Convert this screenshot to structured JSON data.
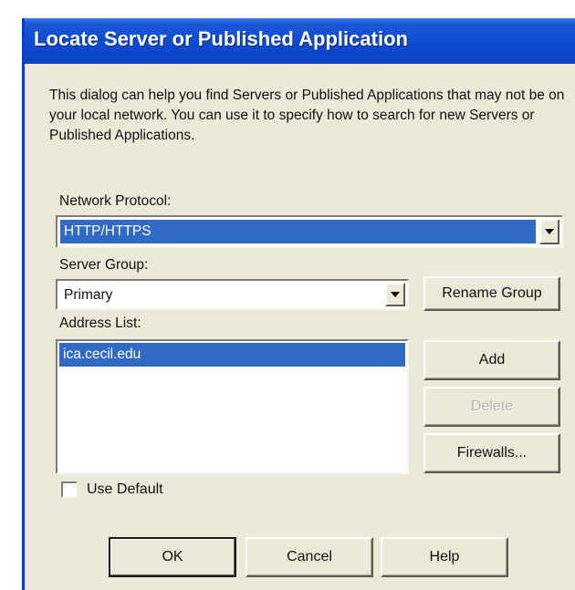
{
  "dialog": {
    "title": "Locate Server or Published Application",
    "description": "This dialog can help you find Servers or Published Applications that may not be on your local network.  You can use it to specify how to search for new Servers or Published Applications."
  },
  "network_protocol": {
    "label": "Network Protocol:",
    "value": "HTTP/HTTPS"
  },
  "server_group": {
    "label": "Server Group:",
    "value": "Primary",
    "rename_label": "Rename Group"
  },
  "address_list": {
    "label": "Address List:",
    "items": [
      "ica.cecil.edu"
    ],
    "add_label": "Add",
    "delete_label": "Delete",
    "firewalls_label": "Firewalls..."
  },
  "use_default": {
    "label": "Use Default",
    "checked": false
  },
  "footer": {
    "ok_label": "OK",
    "cancel_label": "Cancel",
    "help_label": "Help"
  },
  "colors": {
    "titlebar": "#0c4ad0",
    "selection": "#316ac5",
    "dialog_bg": "#ece9d8"
  }
}
